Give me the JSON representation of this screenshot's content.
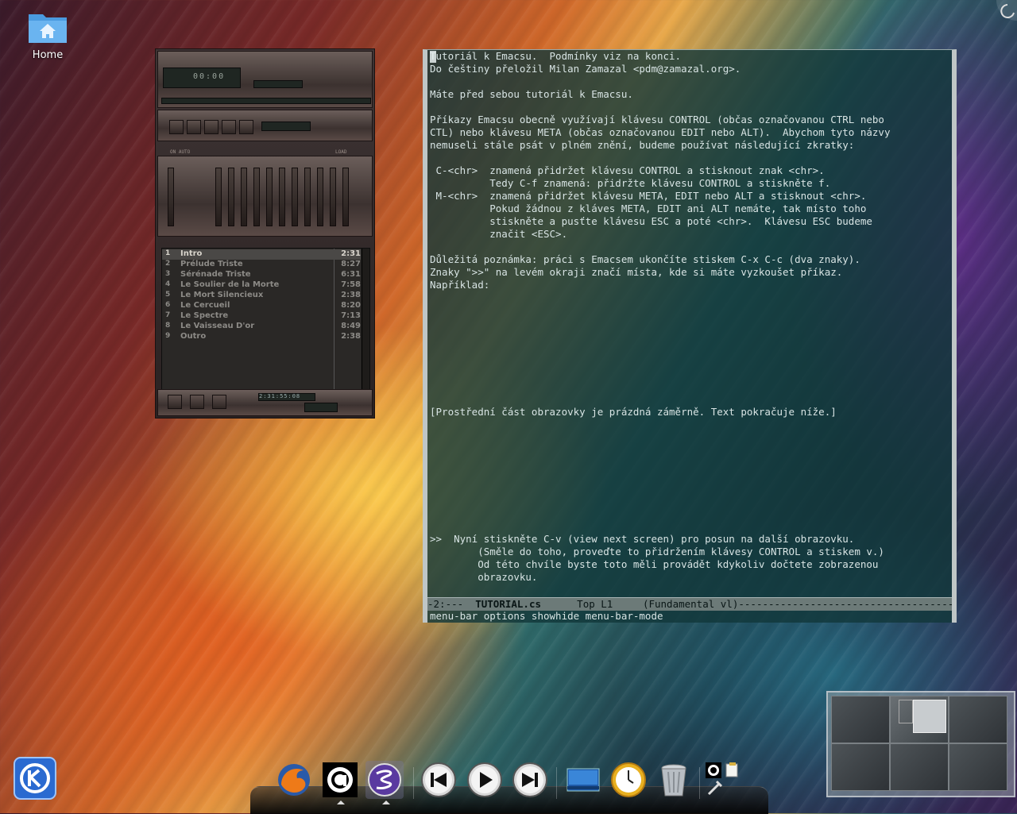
{
  "desktop": {
    "home_icon": {
      "label": "Home",
      "icon": "home-folder-icon"
    }
  },
  "winamp": {
    "time": "00:00",
    "labels": {
      "on_auto": "ON  AUTO",
      "load": "LOAD"
    },
    "counter": "2:31:55:08",
    "playlist": [
      {
        "num": "1",
        "title": "Intro",
        "duration": "2:31",
        "selected": true
      },
      {
        "num": "2",
        "title": "Prélude Triste",
        "duration": "8:27"
      },
      {
        "num": "3",
        "title": "Sérénade Triste",
        "duration": "6:31"
      },
      {
        "num": "4",
        "title": "Le Soulier de la Morte",
        "duration": "7:58"
      },
      {
        "num": "5",
        "title": "Le Mort Silencieux",
        "duration": "2:38"
      },
      {
        "num": "6",
        "title": "Le Cercueil",
        "duration": "8:20"
      },
      {
        "num": "7",
        "title": "Le Spectre",
        "duration": "7:13"
      },
      {
        "num": "8",
        "title": "Le Vaisseau D'or",
        "duration": "8:49"
      },
      {
        "num": "9",
        "title": "Outro",
        "duration": "2:38"
      }
    ]
  },
  "emacs": {
    "buffer_text": "Tutoriál k Emacsu.  Podmínky viz na konci.\nDo češtiny přeložil Milan Zamazal <pdm@zamazal.org>.\n\nMáte před sebou tutoriál k Emacsu.\n\nPříkazy Emacsu obecně využívají klávesu CONTROL (občas označovanou CTRL nebo\nCTL) nebo klávesu META (občas označovanou EDIT nebo ALT).  Abychom tyto názvy\nnemuseli stále psát v plném znění, budeme používat následující zkratky:\n\n C-<chr>  znamená přidržet klávesu CONTROL a stisknout znak <chr>.\n          Tedy C-f znamená: přidržte klávesu CONTROL a stiskněte f.\n M-<chr>  znamená přidržet klávesu META, EDIT nebo ALT a stisknout <chr>.\n          Pokud žádnou z kláves META, EDIT ani ALT nemáte, tak místo toho\n          stiskněte a pusťte klávesu ESC a poté <chr>.  Klávesu ESC budeme\n          značit <ESC>.\n\nDůležitá poznámka: práci s Emacsem ukončíte stiskem C-x C-c (dva znaky).\nZnaky \">>\" na levém okraji značí místa, kde si máte vyzkoušet příkaz.\nNapříklad:\n\n\n\n\n\n\n\n\n\n[Prostřední část obrazovky je prázdná záměrně. Text pokračuje níže.]\n\n\n\n\n\n\n\n\n\n>>  Nyní stiskněte C-v (view next screen) pro posun na další obrazovku.\n        (Směle do toho, proveďte to přidržením klávesy CONTROL a stiskem v.)\n        Od této chvíle byste toto měli provádět kdykoliv dočtete zobrazenou\n        obrazovku.",
    "modeline": {
      "status": "-2:---  ",
      "buffer": "TUTORIAL.cs",
      "position": "      Top L1     ",
      "mode": "(Fundamental vl)",
      "fill": "-------------------------------------------------"
    },
    "minibuffer": "menu-bar options showhide menu-bar-mode"
  },
  "taskbar": {
    "kickoff_icon": "kde-logo-icon",
    "dock_items": [
      {
        "name": "firefox-icon"
      },
      {
        "name": "amarok-icon"
      },
      {
        "name": "emacs-icon"
      },
      {
        "name": "previous-track-icon"
      },
      {
        "name": "play-icon"
      },
      {
        "name": "next-track-icon"
      },
      {
        "name": "show-desktop-icon"
      },
      {
        "name": "clock-icon"
      },
      {
        "name": "trash-icon"
      }
    ],
    "pager": {
      "desktops": 6,
      "active": 2
    }
  },
  "colors": {
    "emacs_bg": "#12373a",
    "emacs_text": "#d8e4e4",
    "modeline_bg": "#6c7a78",
    "playlist_text": "#8c8a86"
  }
}
